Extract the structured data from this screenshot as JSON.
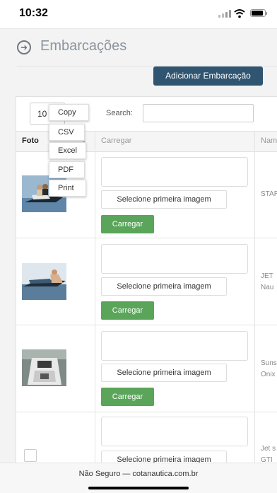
{
  "status": {
    "time": "10:32"
  },
  "header": {
    "title": "Embarcações"
  },
  "actions": {
    "add_label": "Adicionar Embarcação"
  },
  "controls": {
    "length_value": "10",
    "search_label": "Search:",
    "search_value": ""
  },
  "export_menu": [
    "Copy",
    "CSV",
    "Excel",
    "PDF",
    "Print"
  ],
  "table": {
    "columns": [
      "Foto",
      "Carregar",
      "Nam"
    ],
    "upload_label": "Selecione primeira imagem",
    "carregar_label": "Carregar",
    "rows": [
      {
        "name_lines": [
          "STAR"
        ],
        "photo": "jetski-riders-icon"
      },
      {
        "name_lines": [
          "JET",
          "Nau"
        ],
        "photo": "jetski-woman-icon"
      },
      {
        "name_lines": [
          "Suns",
          "Onix"
        ],
        "photo": "boat-deck-icon"
      },
      {
        "name_lines": [
          "Jet s",
          "GTI"
        ],
        "photo": "no-photo"
      }
    ]
  },
  "browser": {
    "url_text": "Não Seguro — cotanautica.com.br"
  },
  "colors": {
    "primary": "#2f5571",
    "success": "#5aa55a"
  }
}
